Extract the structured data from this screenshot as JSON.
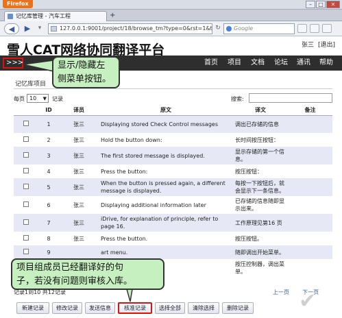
{
  "browser": {
    "menu_label": "Firefox",
    "tab_title": "记忆库管理 - 汽车工程",
    "new_tab": "+",
    "url": "127.0.0.1:9001/project/18/browse_tm?type=0&rst=1&tar",
    "search_placeholder": "Google",
    "back": "◀",
    "forward": "▶",
    "minimize": "–",
    "maximize": "□",
    "close": "✕"
  },
  "site": {
    "title": "雪人CAT网络协同翻译平台",
    "user": "张三",
    "logout": "[退出]"
  },
  "menu": {
    "toggle": ">>>",
    "items": [
      "首页",
      "项目",
      "文档",
      "论坛",
      "通讯",
      "帮助"
    ]
  },
  "callouts": {
    "top": "显示/隐藏左侧菜单按钮。",
    "top_line1": "显示/隐藏左",
    "top_line2": "侧菜单按钮。",
    "bottom_line1": "项目组成员已经翻译好的句",
    "bottom_line2": "子，若没有问题则审核入库。"
  },
  "section": {
    "title": "记忆库项目",
    "per_page_label": "每页",
    "per_page_value": "10",
    "records_label": "记录",
    "search_label": "搜索:"
  },
  "table": {
    "headers": [
      "",
      "ID",
      "译员",
      "原文",
      "译文",
      "备注"
    ],
    "rows": [
      {
        "id": "1",
        "translator": "张三",
        "source": "Displaying stored Check Control messages",
        "target": "调出已存储的信息",
        "note": ""
      },
      {
        "id": "2",
        "translator": "张三",
        "source": "Hold the button down:",
        "target": "长时间按压按钮：",
        "note": ""
      },
      {
        "id": "3",
        "translator": "张三",
        "source": "The first stored message is displayed.",
        "target": "显示存储的第一个信息。",
        "note": ""
      },
      {
        "id": "4",
        "translator": "张三",
        "source": "Press the button:",
        "target": "按压按钮：",
        "note": ""
      },
      {
        "id": "5",
        "translator": "张三",
        "source": "When the button is pressed again, a different message is displayed.",
        "target": "每按一下按钮后，就会显示下一条信息。",
        "note": ""
      },
      {
        "id": "6",
        "translator": "张三",
        "source": "Displaying additional information later",
        "target": "已存储的信息随即显示出来。",
        "note": ""
      },
      {
        "id": "7",
        "translator": "张三",
        "source": "iDrive, for explanation of principle, refer to page 16.",
        "target": "工作原理见第16 页",
        "note": ""
      },
      {
        "id": "8",
        "translator": "张三",
        "source": "Press the button.",
        "target": "按压按钮。",
        "note": ""
      },
      {
        "id": "9",
        "translator": "",
        "source": "art menu.",
        "target": "随即调出开始菜单。",
        "note": ""
      },
      {
        "id": "10",
        "translator": "",
        "source": "er to open the menu.",
        "target": "按压控制器，调出菜单。",
        "note": ""
      }
    ]
  },
  "pager": {
    "info": "记录1到10 共12记录",
    "prev": "上一页",
    "next": "下一页"
  },
  "actions": [
    "新建记录",
    "修改记录",
    "发送信息",
    "核准记录",
    "选择全部",
    "清除选择",
    "删除记录"
  ]
}
